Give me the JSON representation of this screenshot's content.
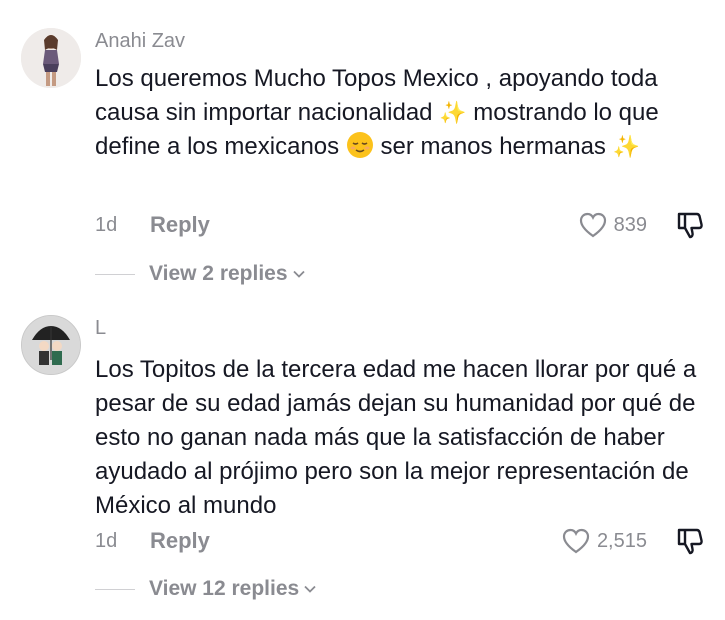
{
  "comments": [
    {
      "username": "Anahi Zav",
      "text_parts": [
        "Los queremos Mucho Topos Mexico , apoyando toda causa sin importar nacionalidad ",
        " mostrando lo que define a los mexicanos ",
        " ser manos hermanas "
      ],
      "age": "1d",
      "reply_label": "Reply",
      "likes": "839",
      "view_replies": "View 2 replies",
      "avatar_icon": "user-photo-avatar"
    },
    {
      "username": "L",
      "text": "Los Topitos de la tercera edad me hacen llorar por qué a pesar de su edad jamás dejan su humanidad por qué de esto no ganan nada más que la satisfacción de haber ayudado al prójimo pero son la mejor representación de México al mundo",
      "age": "1d",
      "reply_label": "Reply",
      "likes": "2,515",
      "view_replies": "View 12 replies",
      "avatar_icon": "umbrella-couple-avatar"
    }
  ],
  "emoji": {
    "sparkles": "✨",
    "relieved": "😌"
  },
  "colors": {
    "text": "#161823",
    "secondary": "#8a8b91",
    "divider": "#d0d0d3"
  }
}
